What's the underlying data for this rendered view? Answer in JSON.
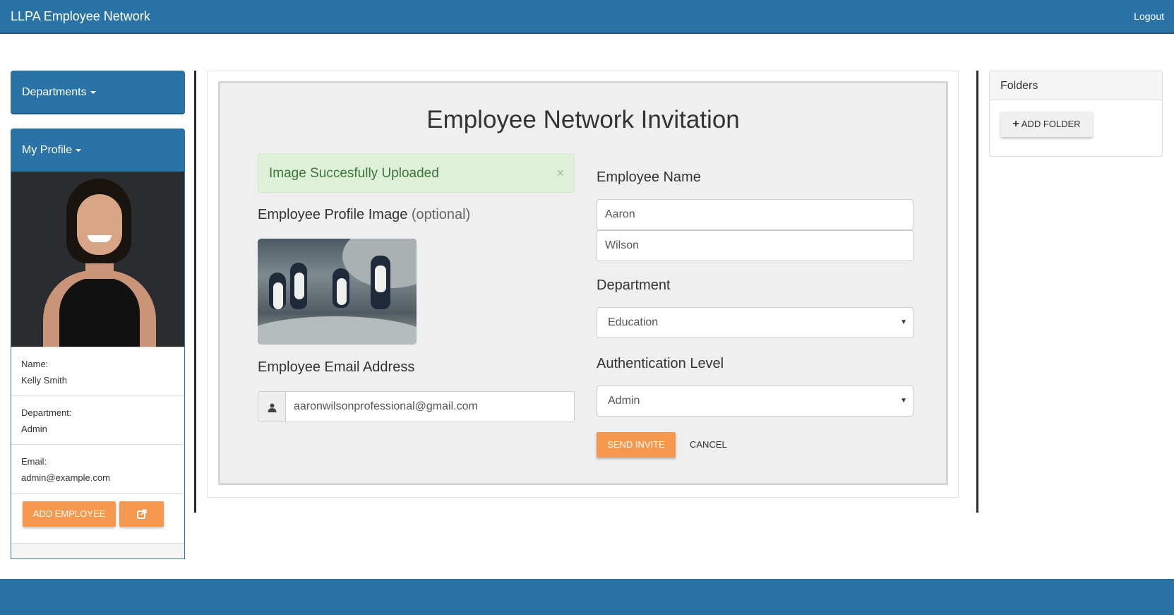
{
  "navbar": {
    "brand": "LLPA Employee Network",
    "logout": "Logout"
  },
  "sidebar": {
    "departments_label": "Departments",
    "my_profile_label": "My Profile",
    "profile": {
      "name_label": "Name:",
      "name": "Kelly Smith",
      "department_label": "Department:",
      "department": "Admin",
      "email_label": "Email:",
      "email": "admin@example.com"
    },
    "add_employee_label": "ADD EMPLOYEE",
    "external_link_icon": "external-link-icon"
  },
  "form": {
    "title": "Employee Network Invitation",
    "alert": {
      "text": "Image Succesfully Uploaded",
      "close": "×"
    },
    "profile_image_label": "Employee Profile Image",
    "profile_image_optional": "(optional)",
    "email_label": "Employee Email Address",
    "email_value": "aaronwilsonprofessional@gmail.com",
    "email_icon": "user-icon",
    "name_label": "Employee Name",
    "first_name": "Aaron",
    "last_name": "Wilson",
    "department_label": "Department",
    "department_value": "Education",
    "auth_label": "Authentication Level",
    "auth_value": "Admin",
    "send_label": "SEND INVITE",
    "cancel_label": "CANCEL"
  },
  "folders": {
    "title": "Folders",
    "add_label": "ADD FOLDER"
  },
  "colors": {
    "primary": "#2a73a7",
    "accent": "#f7984f",
    "success_bg": "#dff0d8"
  }
}
